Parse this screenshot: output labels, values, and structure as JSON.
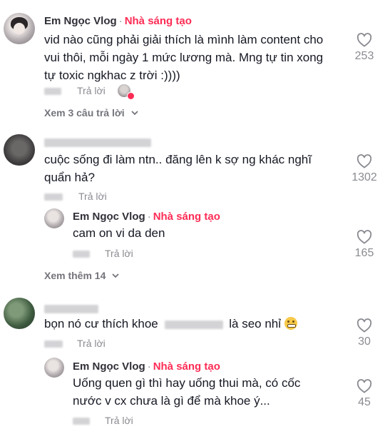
{
  "comments": [
    {
      "author": "Em Ngọc Vlog",
      "badge": "Nhà sáng tạo",
      "text": "vid nào cũng phải giải thích là mình làm content cho vui thôi, mỗi ngày 1 mức lương mà. Mng tự tin xong tự toxic ngkhac z trời :))))",
      "reply_label": "Trả lời",
      "likes": "253",
      "view_replies": "Xem 3 câu trả lời"
    },
    {
      "text": "cuộc sống đi làm ntn.. đăng lên k sợ ng khác nghĩ quẩn hả?",
      "reply_label": "Trả lời",
      "likes": "1302",
      "reply": {
        "author": "Em Ngọc Vlog",
        "badge": "Nhà sáng tạo",
        "text": "cam on vi da den",
        "reply_label": "Trả lời",
        "likes": "165"
      },
      "view_more": "Xem thêm 14"
    },
    {
      "text_start": "bọn nó cư thích khoe",
      "text_end": "là seo nhỉ",
      "reply_label": "Trả lời",
      "likes": "30",
      "reply": {
        "author": "Em Ngọc Vlog",
        "badge": "Nhà sáng tạo",
        "text": "Uống quen gì thì hay uống thui mà, có cốc nước v cx chưa là gì để mà khoe ý...",
        "reply_label": "Trả lời",
        "likes": "45"
      }
    }
  ],
  "colors": {
    "creator": "#fe2c55",
    "muted": "#8a8b91",
    "text": "#161823"
  },
  "icons": {
    "like": "heart-outline-icon",
    "expand": "chevron-down-icon"
  }
}
